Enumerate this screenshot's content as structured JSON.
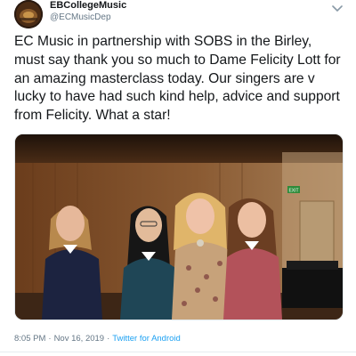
{
  "tweet": {
    "display_name": "EBCollegeMusic",
    "handle": "@ECMusicDep",
    "text": "EC Music in partnership with SOBS in the Birley, must say thank you so much to Dame Felicity Lott for an amazing masterclass today. Our singers are v lucky to have had such kind help, advice and support from Felicity. What a star!",
    "time": "8:05 PM",
    "separator": "·",
    "date": "Nov 16, 2019",
    "source": "Twitter for Android"
  },
  "photo": {
    "exit_sign": "EXIT"
  },
  "icons": {
    "menu": "chevron-down-icon"
  },
  "colors": {
    "link": "#1da1f2",
    "muted": "#657786",
    "text": "#14171a"
  }
}
